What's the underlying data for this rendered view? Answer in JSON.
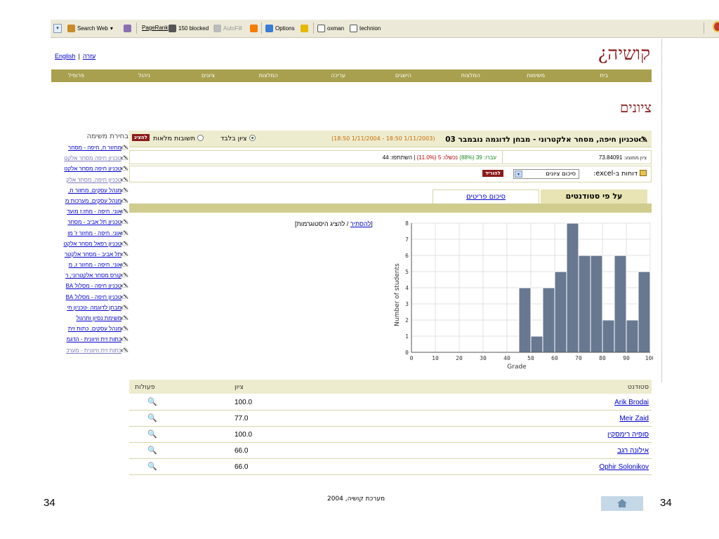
{
  "toolbar": {
    "search_label": "Search Web",
    "pagerank_label": "PageRank",
    "blocked_label": "150 blocked",
    "autofill_label": "AutoFill",
    "options_label": "Options",
    "oxman_label": "oxman",
    "technion_label": "technion"
  },
  "header": {
    "english_link": "English",
    "help_link": "עזרה",
    "logo_text": "קושיה¿"
  },
  "nav": [
    "בית",
    "משימות",
    "המלצות",
    "הישגים",
    "עריכה",
    "המלצות",
    "ציונים",
    "ניהול",
    "פרופיל"
  ],
  "page_title": "ציונים",
  "sidebar": {
    "title": "בחירת משימה",
    "items": [
      {
        "text": "מחזור ח, חיפה - מסחר",
        "dim": false
      },
      {
        "text": "טכניון חיפה מסחר אלקט",
        "dim": true
      },
      {
        "text": "טכניון חיפה מסחר אלקט",
        "dim": false
      },
      {
        "text": "טכניון חיפה, מסחר אלק",
        "dim": true
      },
      {
        "text": "מנהל עסקים, מחזור ח,",
        "dim": false
      },
      {
        "text": "מנהל עסקים, מערכות מ",
        "dim": false
      },
      {
        "text": "אוני. חיפה - מחז.ז מועד",
        "dim": false
      },
      {
        "text": "טכניון תל אביב - מסחר",
        "dim": false
      },
      {
        "text": "אוני. חיפה - מחזור ז' מו",
        "dim": false
      },
      {
        "text": "טכניון רפאל מסחר אלקט",
        "dim": false
      },
      {
        "text": "תל אביב - מסחר אלקטר",
        "dim": false
      },
      {
        "text": "אוני. חיפה - מחזור ז, מ",
        "dim": false
      },
      {
        "text": "קורס מסחר אלקטרוני, ר",
        "dim": false
      },
      {
        "text": "טכניון חיפה - מסלול BA",
        "dim": false
      },
      {
        "text": "טכניון חיפה - מסלול BA",
        "dim": false
      },
      {
        "text": "מבחן לדוגמה -טכניון חי",
        "dim": false
      },
      {
        "text": "משימת נסיון ותרגול",
        "dim": false
      },
      {
        "text": "מנהל עסקים, כתות זית",
        "dim": false
      },
      {
        "text": "כתות זית וזיוונית - הדגמ",
        "dim": false
      },
      {
        "text": "כתות זית וזיוונית - מערכ",
        "dim": true
      }
    ]
  },
  "task": {
    "title": "טכניון חיפה, מסחר אלקטרוני - מבחן לדוגמה נובמבר 03",
    "dates": "(18:50 1/11/2004 - 18:50 1/11/2003)",
    "radio_grade_only": "ציון בלבד",
    "radio_full_answers": "תשובות מלאות",
    "show_button": "להציג",
    "avg_label": "ציון ממוצע:",
    "avg_value": "73.84091",
    "passed_text": "עברו: 39 (88%)",
    "failed_text": "נכשלו: 5 (11.0%)",
    "participants_text": "השתתפו: 44",
    "excel_label": "דוחות ב-excel:",
    "report_select": "סיכום ציונים",
    "download_button": "להוריד",
    "tab_students": "על פי סטודנטים",
    "tab_items": "סיכום פריטים",
    "hist_toggle_link": "להסתיר",
    "hist_toggle_rest": "להציג היסטוגרמות"
  },
  "chart_data": {
    "type": "bar",
    "xlabel": "Grade",
    "ylabel": "Number of students",
    "xlim": [
      0,
      100
    ],
    "ylim": [
      0,
      8
    ],
    "xticks": [
      0,
      10,
      20,
      30,
      40,
      50,
      60,
      70,
      80,
      90,
      100
    ],
    "yticks": [
      0,
      1,
      2,
      3,
      4,
      5,
      6,
      7,
      8
    ],
    "grid": true,
    "bin_width": 5,
    "bins": [
      {
        "x0": 45,
        "count": 4
      },
      {
        "x0": 50,
        "count": 1
      },
      {
        "x0": 55,
        "count": 4
      },
      {
        "x0": 60,
        "count": 5
      },
      {
        "x0": 65,
        "count": 8
      },
      {
        "x0": 70,
        "count": 6
      },
      {
        "x0": 75,
        "count": 6
      },
      {
        "x0": 80,
        "count": 2
      },
      {
        "x0": 85,
        "count": 6
      },
      {
        "x0": 90,
        "count": 2
      },
      {
        "x0": 95,
        "count": 5
      }
    ],
    "bar_color": "#687890"
  },
  "table": {
    "col_student": "סטודנט",
    "col_grade": "ציון",
    "col_actions": "פעולות",
    "rows": [
      {
        "name": "Arik Brodai",
        "grade": "100.0"
      },
      {
        "name": "Meir Zaid",
        "grade": "77.0"
      },
      {
        "name": "סופיה רימסקין",
        "grade": "100.0"
      },
      {
        "name": "אילונה רגב",
        "grade": "66.0"
      },
      {
        "name": "Ophir Solonikov",
        "grade": "66.0"
      }
    ]
  },
  "footer": {
    "page_left": "34",
    "page_right": "34",
    "copyright": "מערכת קושיה, 2004"
  }
}
